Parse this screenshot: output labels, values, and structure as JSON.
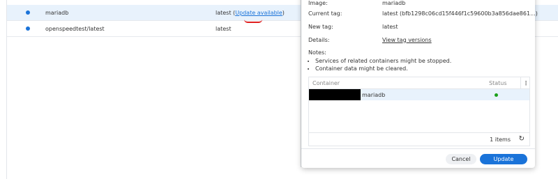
{
  "list": {
    "rows": [
      {
        "name": "mariadb",
        "tag": "latest",
        "tag_link": "Update available"
      },
      {
        "name": "openspeedtest/latest",
        "tag": "latest",
        "tag_link": ""
      }
    ]
  },
  "dialog": {
    "image_label": "Image:",
    "image_value": "mariadb",
    "current_tag_label": "Current tag:",
    "current_tag_value": "latest (bfb1298c06cd15f446f1c59600b3a856dae861...)",
    "new_tag_label": "New tag:",
    "new_tag_value": "latest",
    "details_label": "Details:",
    "details_link": "View tag versions",
    "notes_title": "Notes:",
    "notes": [
      "Services of related containers might be stopped.",
      "Container data might be cleared."
    ],
    "table": {
      "col_container": "Container",
      "col_status": "Status",
      "menu_glyph": "⋮",
      "rows": [
        {
          "container": "mariadb",
          "status": "running"
        }
      ],
      "items_count": "1 items"
    },
    "cancel_label": "Cancel",
    "update_label": "Update"
  },
  "colors": {
    "accent": "#1a73d9",
    "selected_row": "#e8f2fc",
    "status_ok": "#1aa01a",
    "annotation": "#e02020"
  }
}
